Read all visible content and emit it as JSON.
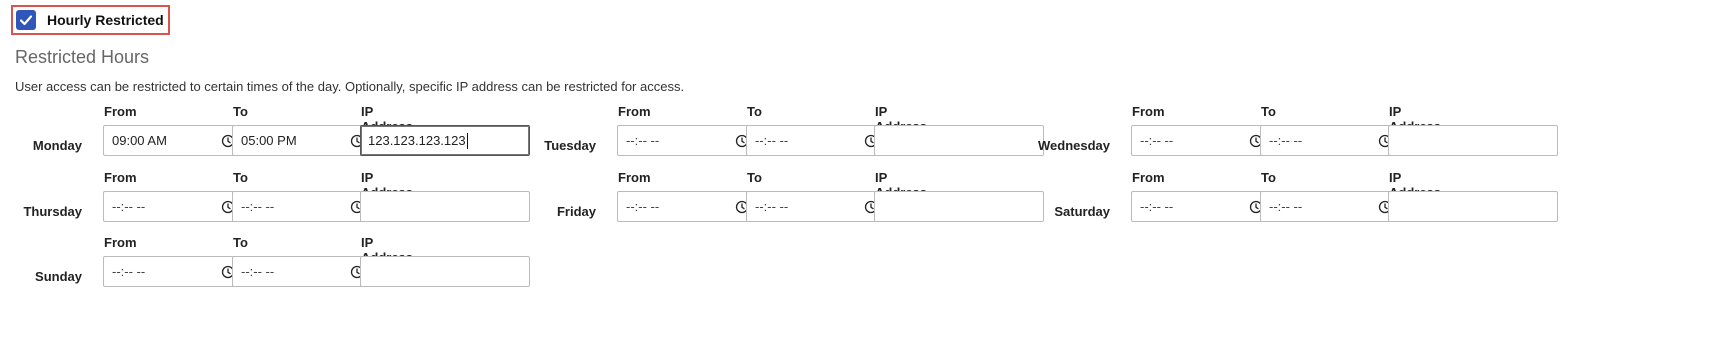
{
  "hourly_restricted": {
    "label": "Hourly Restricted",
    "checked": true
  },
  "section": {
    "title": "Restricted Hours",
    "description": "User access can be restricted to certain times of the day. Optionally, specific IP address can be restricted for access."
  },
  "columns": {
    "from": "From",
    "to": "To",
    "ip": "IP Address"
  },
  "days": [
    {
      "name": "Monday",
      "from": "09:00 AM",
      "to": "05:00 PM",
      "ip": "123.123.123.123"
    },
    {
      "name": "Tuesday",
      "from": "--:-- --",
      "to": "--:-- --",
      "ip": ""
    },
    {
      "name": "Wednesday",
      "from": "--:-- --",
      "to": "--:-- --",
      "ip": ""
    },
    {
      "name": "Thursday",
      "from": "--:-- --",
      "to": "--:-- --",
      "ip": ""
    },
    {
      "name": "Friday",
      "from": "--:-- --",
      "to": "--:-- --",
      "ip": ""
    },
    {
      "name": "Saturday",
      "from": "--:-- --",
      "to": "--:-- --",
      "ip": ""
    },
    {
      "name": "Sunday",
      "from": "--:-- --",
      "to": "--:-- --",
      "ip": ""
    }
  ],
  "icons": {
    "checkbox": "checkmark-icon",
    "time": "clock-icon"
  },
  "colors": {
    "accent": "#2f56b8",
    "highlight_border": "#d9534f"
  }
}
